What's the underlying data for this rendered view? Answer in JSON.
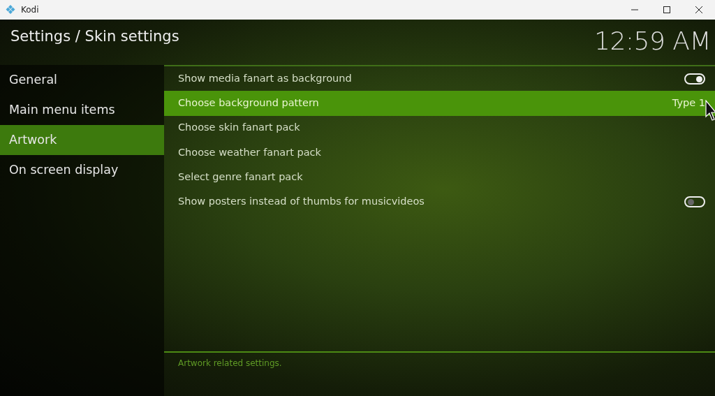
{
  "window": {
    "title": "Kodi"
  },
  "header": {
    "breadcrumb": "Settings / Skin settings",
    "clock": "12:59 AM"
  },
  "sidebar": {
    "items": [
      {
        "label": "General",
        "selected": false
      },
      {
        "label": "Main menu items",
        "selected": false
      },
      {
        "label": "Artwork",
        "selected": true
      },
      {
        "label": "On screen display",
        "selected": false
      }
    ]
  },
  "settings": [
    {
      "kind": "toggle",
      "label": "Show media fanart as background",
      "on": true,
      "selected": false
    },
    {
      "kind": "value",
      "label": "Choose background pattern",
      "value": "Type 1",
      "selected": true
    },
    {
      "kind": "action",
      "label": "Choose skin fanart pack",
      "selected": false
    },
    {
      "kind": "action",
      "label": "Choose weather fanart pack",
      "selected": false
    },
    {
      "kind": "action",
      "label": "Select genre fanart pack",
      "selected": false
    },
    {
      "kind": "toggle",
      "label": "Show posters instead of thumbs for musicvideos",
      "on": false,
      "selected": false
    }
  ],
  "description": "Artwork related settings."
}
